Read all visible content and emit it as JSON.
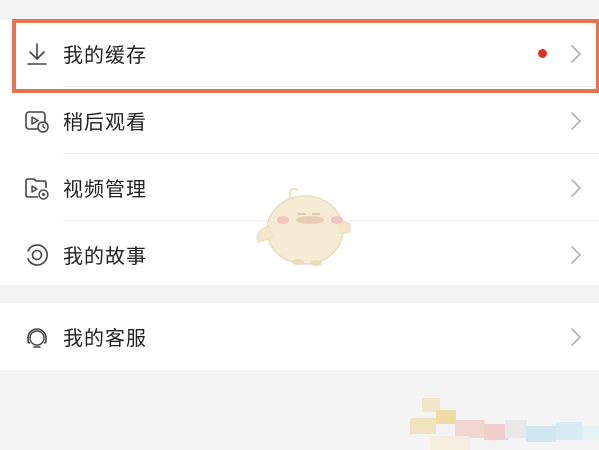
{
  "menu_group_1": {
    "items": [
      {
        "label": "我的缓存",
        "icon": "download-icon",
        "has_dot": true
      },
      {
        "label": "稍后观看",
        "icon": "watch-later-icon"
      },
      {
        "label": "视频管理",
        "icon": "video-folder-icon"
      },
      {
        "label": "我的故事",
        "icon": "story-icon"
      }
    ]
  },
  "menu_group_2": {
    "items": [
      {
        "label": "我的客服",
        "icon": "headset-icon"
      }
    ]
  },
  "colors": {
    "background": "#f4f4f4",
    "highlight_border": "#e8744f",
    "notification_dot": "#e2332b",
    "chevron": "#b0b0b0"
  }
}
